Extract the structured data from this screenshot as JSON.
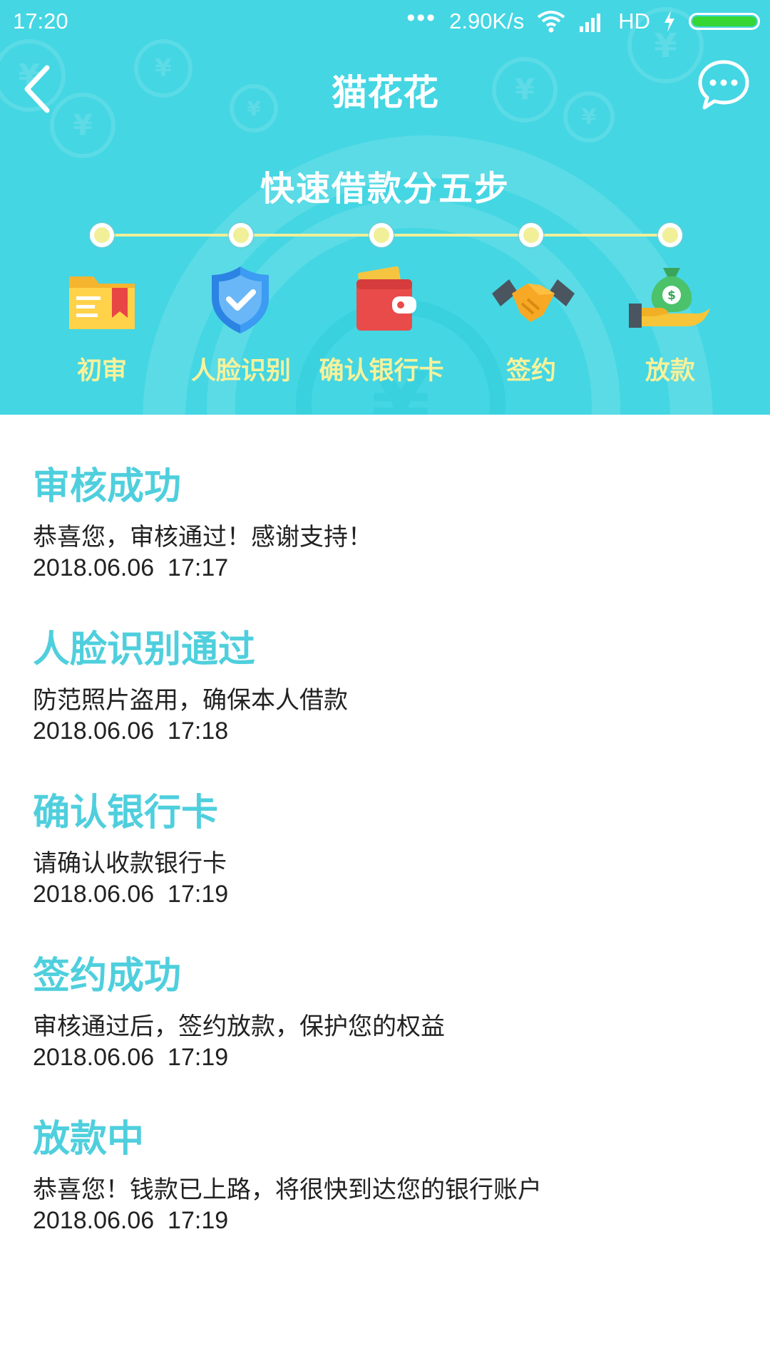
{
  "status_bar": {
    "time": "17:20",
    "dots": "•••",
    "speed": "2.90K/s",
    "network": "HD"
  },
  "nav": {
    "title": "猫花花"
  },
  "steps": {
    "title": "快速借款分五步",
    "items": [
      {
        "label": "初审",
        "icon": "folder-icon"
      },
      {
        "label": "人脸识别",
        "icon": "shield-check-icon"
      },
      {
        "label": "确认银行卡",
        "icon": "wallet-icon"
      },
      {
        "label": "签约",
        "icon": "handshake-icon"
      },
      {
        "label": "放款",
        "icon": "money-bag-hand-icon"
      }
    ]
  },
  "records": [
    {
      "title": "审核成功",
      "desc": "恭喜您，审核通过！感谢支持！",
      "time": "2018.06.06  17:17"
    },
    {
      "title": "人脸识别通过",
      "desc": "防范照片盗用，确保本人借款",
      "time": "2018.06.06  17:18"
    },
    {
      "title": "确认银行卡",
      "desc": "请确认收款银行卡",
      "time": "2018.06.06  17:19"
    },
    {
      "title": "签约成功",
      "desc": "审核通过后，签约放款，保护您的权益",
      "time": "2018.06.06  17:19"
    },
    {
      "title": "放款中",
      "desc": "恭喜您！钱款已上路，将很快到达您的银行账户",
      "time": "2018.06.06  17:19"
    }
  ],
  "colors": {
    "header_bg": "#44d6e3",
    "accent_title": "#4fcfdd",
    "step_label": "#f6f29c",
    "battery": "#36d635"
  }
}
